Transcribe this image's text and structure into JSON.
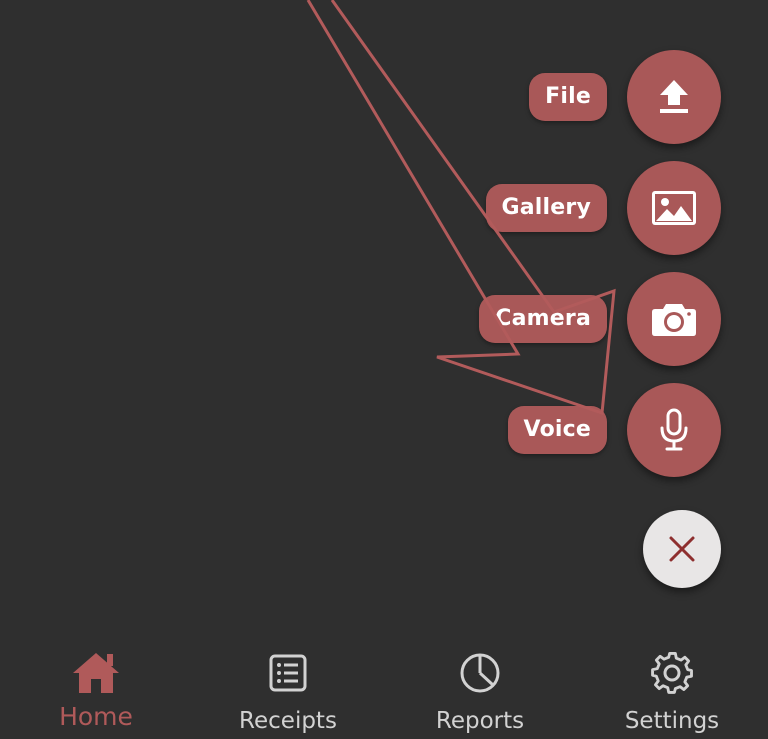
{
  "colors": {
    "background": "#2f2f2f",
    "accent": "#a95858",
    "nav_active": "#b05a5a",
    "nav_inactive": "#d2d2d2",
    "close_fab_bg": "#e8e6e6",
    "close_icon": "#8e2f2f",
    "annotation_stroke": "#b25b5b"
  },
  "speed_dial": {
    "actions": [
      {
        "label": "File",
        "icon": "upload-icon"
      },
      {
        "label": "Gallery",
        "icon": "image-icon"
      },
      {
        "label": "Camera",
        "icon": "camera-icon"
      },
      {
        "label": "Voice",
        "icon": "microphone-icon"
      }
    ],
    "close_icon": "close-icon"
  },
  "bottom_nav": {
    "items": [
      {
        "label": "Home",
        "icon": "home-icon",
        "active": true
      },
      {
        "label": "Receipts",
        "icon": "list-icon",
        "active": false
      },
      {
        "label": "Reports",
        "icon": "pie-chart-icon",
        "active": false
      },
      {
        "label": "Settings",
        "icon": "gear-icon",
        "active": false
      }
    ]
  }
}
